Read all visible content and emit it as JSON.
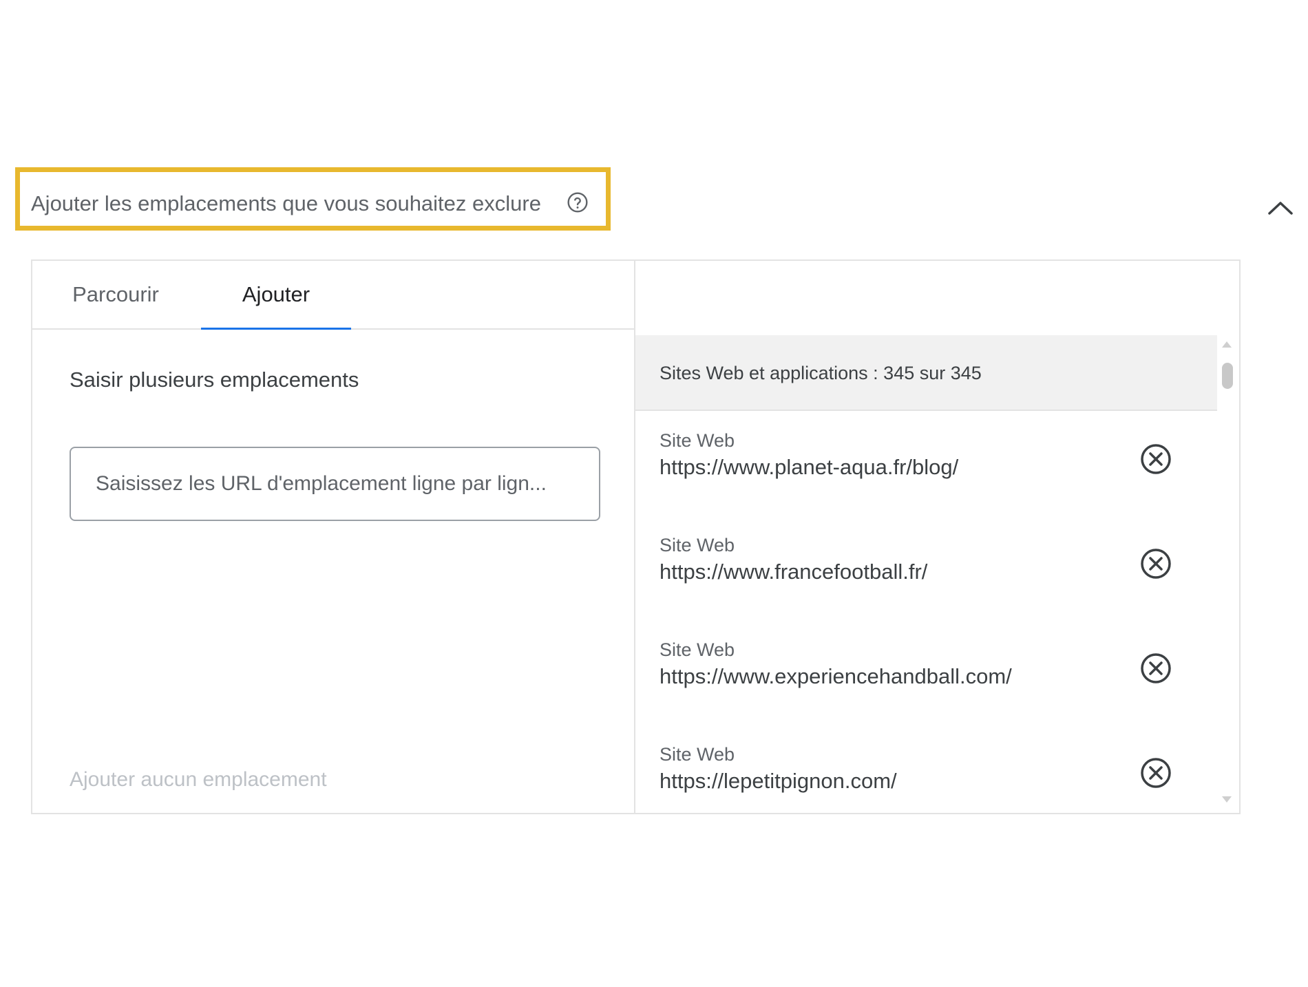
{
  "section": {
    "title": "Ajouter les emplacements que vous souhaitez exclure",
    "help_icon": "help-circle-icon",
    "collapse_icon": "chevron-up-icon",
    "highlight_color": "#e8b82e"
  },
  "tabs": [
    {
      "label": "Parcourir",
      "active": false
    },
    {
      "label": "Ajouter",
      "active": true
    }
  ],
  "add_panel": {
    "label": "Saisir plusieurs emplacements",
    "input_placeholder": "Saisissez les URL d'emplacement ligne par lign...",
    "input_value": "",
    "add_none_label": "Ajouter aucun emplacement"
  },
  "list": {
    "header": "Sites Web et applications : 345 sur 345",
    "remove_icon": "close-circle-icon",
    "items": [
      {
        "type": "Site Web",
        "url": "https://www.planet-aqua.fr/blog/"
      },
      {
        "type": "Site Web",
        "url": "https://www.francefootball.fr/"
      },
      {
        "type": "Site Web",
        "url": "https://www.experiencehandball.com/"
      },
      {
        "type": "Site Web",
        "url": "https://lepetitpignon.com/"
      }
    ]
  },
  "colors": {
    "tab_active_underline": "#1a73e8",
    "text_primary": "#3c4043",
    "text_secondary": "#5f6368",
    "text_disabled": "#bdc1c6"
  }
}
